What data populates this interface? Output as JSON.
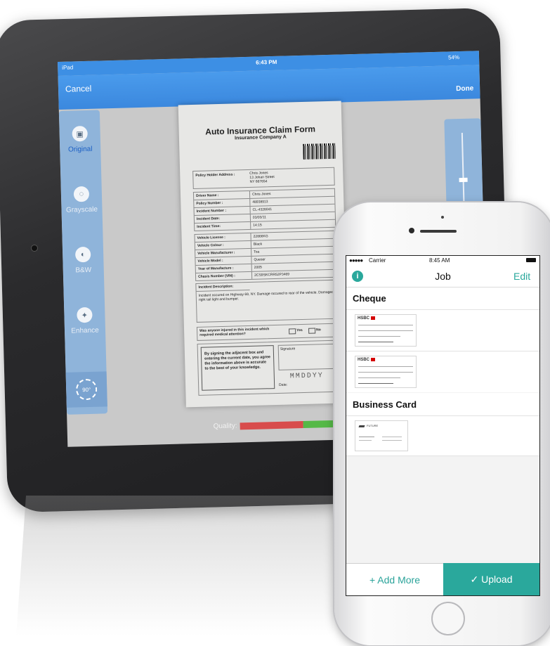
{
  "ipad": {
    "status_left": "iPad",
    "status_time": "6:43 PM",
    "status_battery": "54%",
    "cancel_label": "Cancel",
    "done_label": "Done",
    "tools": [
      {
        "label": "Original",
        "icon": "image-icon"
      },
      {
        "label": "Grayscale",
        "icon": "grayscale-icon"
      },
      {
        "label": "B&W",
        "icon": "contrast-icon"
      },
      {
        "label": "Enhance",
        "icon": "magic-wand-icon"
      },
      {
        "label": "90°",
        "icon": "rotate-icon"
      }
    ],
    "document": {
      "title": "Auto Insurance Claim Form",
      "subtitle": "Insurance Company A",
      "address_label": "Policy Holder Address :",
      "address_value": [
        "Chris Jones",
        "13 Johan Street",
        "NY 667654"
      ],
      "rows1": [
        {
          "k": "Driver Name :",
          "v": "Chris Jones"
        },
        {
          "k": "Policy Number :",
          "v": "48938913"
        },
        {
          "k": "Incident Number :",
          "v": "CL-4328041"
        },
        {
          "k": "Incident Date:",
          "v": "03/03/11"
        },
        {
          "k": "Incident Time:",
          "v": "14:15"
        }
      ],
      "rows2": [
        {
          "k": "Vehicle License :",
          "v": "22866KG"
        },
        {
          "k": "Vehicle Colour :",
          "v": "Black"
        },
        {
          "k": "Vehicle Manufacturer :",
          "v": "Toa"
        },
        {
          "k": "Vehicle Model :",
          "v": "Queser"
        },
        {
          "k": "Year of Manufacture :",
          "v": "2005"
        },
        {
          "k": "Chasis Number (VIN) :",
          "v": "2CS9SKCRR52P3469"
        }
      ],
      "desc_label": "Incident Description:",
      "desc_text": "Incident occured on Highway 69, NY. Damage occured to rear of the vehicle. Damaged right tail light and bumper.",
      "injured_q": "Was anyone injured in this incident which required medical attention?",
      "yes": "Yes",
      "no": "No",
      "sign_text": "By signing the adjacent box and entering the current date, you agree the information above is accurate to the best of your knowledge.",
      "signature_label": "Signature",
      "date_label": "Date:",
      "date_placeholder": "MMDDYY"
    },
    "quality_label": "Quality:",
    "quality_level": 0.85
  },
  "phone": {
    "carrier": "Carrier",
    "time": "8:45 AM",
    "title": "Job",
    "edit_label": "Edit",
    "sections": [
      {
        "title": "Cheque",
        "items": [
          "HSBC",
          "HSBC"
        ]
      },
      {
        "title": "Business Card",
        "items": [
          "FUTURE"
        ]
      }
    ],
    "add_more_label": "+ Add More",
    "upload_label": "✓ Upload",
    "colors": {
      "accent": "#2aa89c",
      "ipad_nav": "#3d8fe4"
    }
  }
}
